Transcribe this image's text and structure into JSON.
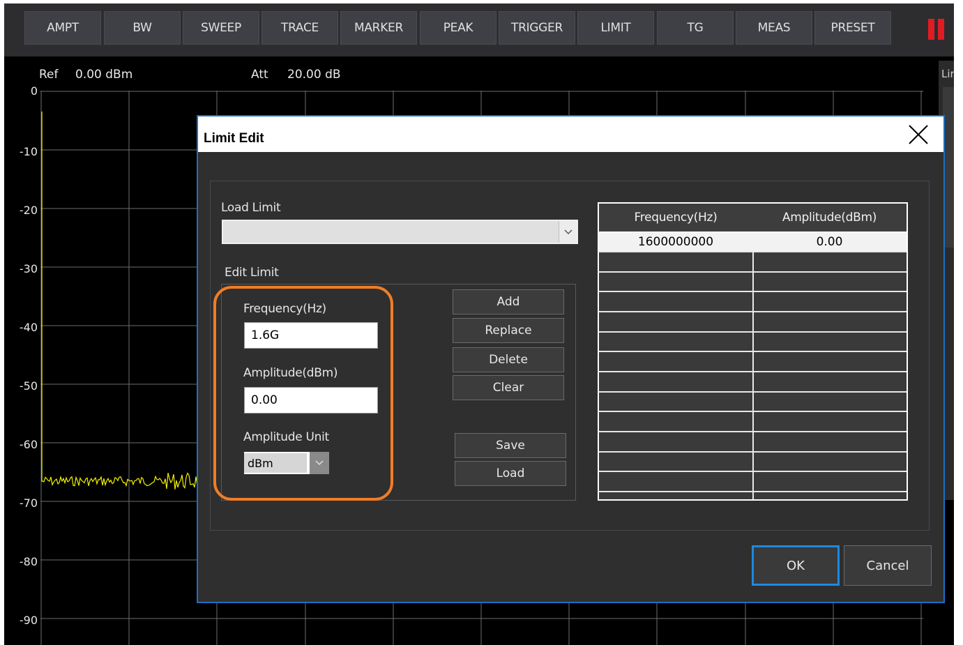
{
  "menu": {
    "items": [
      "AMPT",
      "BW",
      "SWEEP",
      "TRACE",
      "MARKER",
      "PEAK",
      "TRIGGER",
      "LIMIT",
      "TG",
      "MEAS",
      "PRESET"
    ]
  },
  "status": {
    "ref_label": "Ref",
    "ref_value": "0.00 dBm",
    "att_label": "Att",
    "att_value": "20.00 dB",
    "side_label": "Lir"
  },
  "y_ticks": [
    "0",
    "-10",
    "-20",
    "-30",
    "-40",
    "-50",
    "-60",
    "-70",
    "-80",
    "-90"
  ],
  "colors": {
    "trace": "#f2f200",
    "dialog_border": "#1d6fc4",
    "highlight": "#f07d25",
    "pause": "#e21b23"
  },
  "dialog": {
    "title": "Limit Edit",
    "load_limit_label": "Load Limit",
    "load_limit_value": "",
    "edit_limit_label": "Edit Limit",
    "frequency_label": "Frequency(Hz)",
    "frequency_value": "1.6G",
    "amplitude_label": "Amplitude(dBm)",
    "amplitude_value": "0.00",
    "unit_label": "Amplitude Unit",
    "unit_value": "dBm",
    "buttons": {
      "add": "Add",
      "replace": "Replace",
      "delete": "Delete",
      "clear": "Clear",
      "save": "Save",
      "load": "Load",
      "ok": "OK",
      "cancel": "Cancel"
    },
    "table": {
      "columns": [
        "Frequency(Hz)",
        "Amplitude(dBm)"
      ],
      "rows": [
        [
          "1600000000",
          "0.00"
        ]
      ]
    }
  }
}
